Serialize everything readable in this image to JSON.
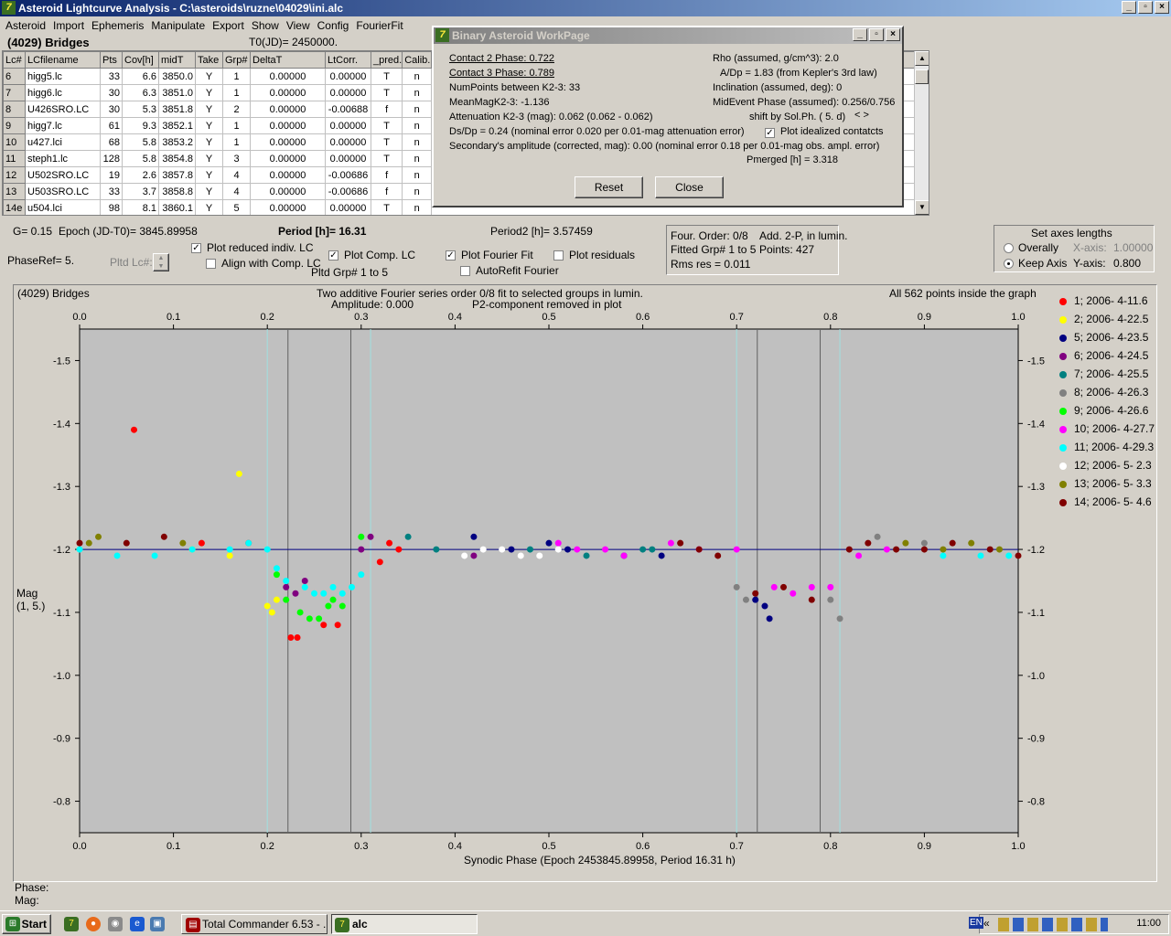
{
  "window": {
    "title": "Asteroid Lightcurve Analysis - C:\\asteroids\\ruzne\\04029\\ini.alc"
  },
  "menu": [
    "Asteroid",
    "Import",
    "Ephemeris",
    "Manipulate",
    "Export",
    "Show",
    "View",
    "Config",
    "FourierFit"
  ],
  "header": {
    "asteroid": "(4029) Bridges",
    "t0": "T0(JD)= 2450000."
  },
  "table": {
    "columns": [
      "Lc#",
      "LCfilename",
      "Pts",
      "Cov[h]",
      "midT",
      "Take",
      "Grp#",
      "DeltaT",
      "LtCorr.",
      "_pred.",
      "Calib."
    ],
    "rows": [
      [
        "6",
        "higg5.lc",
        "33",
        "6.6",
        "3850.0",
        "Y",
        "1",
        "0.00000",
        "0.00000",
        "T",
        "n"
      ],
      [
        "7",
        "higg6.lc",
        "30",
        "6.3",
        "3851.0",
        "Y",
        "1",
        "0.00000",
        "0.00000",
        "T",
        "n"
      ],
      [
        "8",
        "U426SRO.LC",
        "30",
        "5.3",
        "3851.8",
        "Y",
        "2",
        "0.00000",
        "-0.00688",
        "f",
        "n"
      ],
      [
        "9",
        "higg7.lc",
        "61",
        "9.3",
        "3852.1",
        "Y",
        "1",
        "0.00000",
        "0.00000",
        "T",
        "n"
      ],
      [
        "10",
        "u427.lci",
        "68",
        "5.8",
        "3853.2",
        "Y",
        "1",
        "0.00000",
        "0.00000",
        "T",
        "n"
      ],
      [
        "11",
        "steph1.lc",
        "128",
        "5.8",
        "3854.8",
        "Y",
        "3",
        "0.00000",
        "0.00000",
        "T",
        "n"
      ],
      [
        "12",
        "U502SRO.LC",
        "19",
        "2.6",
        "3857.8",
        "Y",
        "4",
        "0.00000",
        "-0.00686",
        "f",
        "n"
      ],
      [
        "13",
        "U503SRO.LC",
        "33",
        "3.7",
        "3858.8",
        "Y",
        "4",
        "0.00000",
        "-0.00686",
        "f",
        "n"
      ],
      [
        "14e",
        "u504.lci",
        "98",
        "8.1",
        "3860.1",
        "Y",
        "5",
        "0.00000",
        "0.00000",
        "T",
        "n"
      ]
    ]
  },
  "dialog": {
    "title": "Binary Asteroid WorkPage",
    "contact2": "Contact 2 Phase:   0.722",
    "contact3": "Contact 3 Phase:   0.789",
    "numpoints": "NumPoints between K2-3:    33",
    "meanmag": "MeanMagK2-3:  -1.136",
    "attenuation": "Attenuation K2-3 (mag):  0.062  (0.062 - 0.062)",
    "dsdp": "Ds/Dp = 0.24 (nominal error 0.020 per 0.01-mag attenuation error)",
    "secondary": "Secondary's amplitude (corrected, mag): 0.00 (nominal error 0.18 per 0.01-mag obs. ampl. error)",
    "rho": "Rho (assumed, g/cm^3): 2.0",
    "adp": "A/Dp = 1.83 (from Kepler's 3rd law)",
    "inclination": "Inclination (assumed, deg): 0",
    "midevent": "MidEvent Phase (assumed): 0.256/0.756",
    "shift": "shift by Sol.Ph. (  5. d)",
    "shift_arrows": "< >",
    "plot_idealized": "Plot idealized contatcts",
    "pmerged": "Pmerged [h] =  3.318",
    "reset": "Reset",
    "close": "Close"
  },
  "info": {
    "g": "G= 0.15",
    "epoch": "Epoch (JD-T0)= 3845.89958",
    "period": "Period [h]= 16.31",
    "period2": "Period2 [h]= 3.57459",
    "phaseref": "PhaseRef= 5.",
    "pltd_lc": "Pltd Lc#:",
    "plot_reduced": "Plot reduced indiv. LC",
    "align_comp": "Align with Comp. LC",
    "plot_comp": "Plot Comp. LC",
    "pltd_grp": "Pltd Grp#   1   to    5",
    "plot_fourier": "Plot Fourier Fit",
    "autorefit": "AutoRefit Fourier",
    "plot_residuals": "Plot residuals",
    "four_order": "Four. Order:  0/8",
    "add2p": "Add. 2-P, in lumin.",
    "fitted": "Fitted Grp# 1 to 5",
    "points": "Points: 427",
    "rms": "Rms res      = 0.011"
  },
  "axes_box": {
    "title": "Set axes lengths",
    "overally": "Overally",
    "keep": "Keep Axis",
    "xaxis": "X-axis:",
    "xval": "1.00000",
    "yaxis": "Y-axis:",
    "yval": "0.800"
  },
  "graph": {
    "name": "(4029) Bridges",
    "subtitle1": "Two additive Fourier series order 0/8 fit to selected groups in lumin.",
    "amp": "Amplitude: 0.000",
    "p2": "P2-component removed in plot",
    "inside": "All 562 points inside the graph",
    "ylabel1": "Mag",
    "ylabel2": "(1, 5.)",
    "xlabel": "Synodic Phase (Epoch 2453845.89958, Period 16.31 h)",
    "phase_lbl": "Phase:",
    "mag_lbl": "Mag:",
    "legend": [
      {
        "label": "1; 2006- 4-11.6",
        "color": "#ff0000"
      },
      {
        "label": "2; 2006- 4-22.5",
        "color": "#ffff00"
      },
      {
        "label": "5; 2006- 4-23.5",
        "color": "#000080"
      },
      {
        "label": "6; 2006- 4-24.5",
        "color": "#800080"
      },
      {
        "label": "7; 2006- 4-25.5",
        "color": "#008080"
      },
      {
        "label": "8; 2006- 4-26.3",
        "color": "#808080"
      },
      {
        "label": "9; 2006- 4-26.6",
        "color": "#00ff00"
      },
      {
        "label": "10; 2006- 4-27.7",
        "color": "#ff00ff"
      },
      {
        "label": "11; 2006- 4-29.3",
        "color": "#00ffff"
      },
      {
        "label": "12; 2006- 5- 2.3",
        "color": "#ffffff"
      },
      {
        "label": "13; 2006- 5- 3.3",
        "color": "#808000"
      },
      {
        "label": "14; 2006- 5- 4.6",
        "color": "#800000"
      }
    ]
  },
  "chart_data": {
    "type": "scatter",
    "xlabel": "Synodic Phase (Epoch 2453845.89958, Period 16.31 h)",
    "ylabel": "Mag",
    "xlim": [
      0.0,
      1.0
    ],
    "ylim": [
      -1.55,
      -0.75
    ],
    "y_inverted": true,
    "xticks": [
      "0.0",
      "0.1",
      "0.2",
      "0.3",
      "0.4",
      "0.5",
      "0.6",
      "0.7",
      "0.8",
      "0.9",
      "1.0"
    ],
    "yticks": [
      "-1.5",
      "-1.4",
      "-1.3",
      "-1.2",
      "-1.1",
      "-1.0",
      "-0.9",
      "-0.8"
    ],
    "fit_line": -1.2,
    "contact_lines": [
      0.222,
      0.289,
      0.722,
      0.789
    ],
    "light_lines": [
      0.2,
      0.31,
      0.7,
      0.81
    ],
    "series": [
      {
        "name": "1; 2006- 4-11.6",
        "color": "#ff0000",
        "x": [
          0.058,
          0.13,
          0.18,
          0.225,
          0.232,
          0.26,
          0.275,
          0.32,
          0.33,
          0.34
        ],
        "y": [
          -1.39,
          -1.21,
          -1.21,
          -1.06,
          -1.06,
          -1.08,
          -1.08,
          -1.18,
          -1.21,
          -1.2
        ]
      },
      {
        "name": "2; 2006- 4-22.5",
        "color": "#ffff00",
        "x": [
          0.17,
          0.12,
          0.16,
          0.2,
          0.205,
          0.21
        ],
        "y": [
          -1.32,
          -1.2,
          -1.19,
          -1.11,
          -1.1,
          -1.12
        ]
      },
      {
        "name": "5; 2006- 4-23.5",
        "color": "#000080",
        "x": [
          0.42,
          0.46,
          0.5,
          0.52,
          0.58,
          0.62,
          0.72,
          0.73,
          0.735
        ],
        "y": [
          -1.22,
          -1.2,
          -1.21,
          -1.2,
          -1.19,
          -1.19,
          -1.12,
          -1.11,
          -1.09
        ]
      },
      {
        "name": "6; 2006- 4-24.5",
        "color": "#800080",
        "x": [
          0.22,
          0.23,
          0.24,
          0.3,
          0.31,
          0.42
        ],
        "y": [
          -1.14,
          -1.13,
          -1.15,
          -1.2,
          -1.22,
          -1.19
        ]
      },
      {
        "name": "7; 2006- 4-25.5",
        "color": "#008080",
        "x": [
          0.35,
          0.38,
          0.48,
          0.54,
          0.6,
          0.61
        ],
        "y": [
          -1.22,
          -1.2,
          -1.2,
          -1.19,
          -1.2,
          -1.2
        ]
      },
      {
        "name": "8; 2006- 4-26.3",
        "color": "#808080",
        "x": [
          0.7,
          0.71,
          0.8,
          0.81,
          0.85,
          0.9
        ],
        "y": [
          -1.14,
          -1.12,
          -1.12,
          -1.09,
          -1.22,
          -1.21
        ]
      },
      {
        "name": "9; 2006- 4-26.6",
        "color": "#00ff00",
        "x": [
          0.21,
          0.22,
          0.235,
          0.245,
          0.255,
          0.265,
          0.27,
          0.28,
          0.3
        ],
        "y": [
          -1.16,
          -1.12,
          -1.1,
          -1.09,
          -1.09,
          -1.11,
          -1.12,
          -1.11,
          -1.22
        ]
      },
      {
        "name": "10; 2006- 4-27.7",
        "color": "#ff00ff",
        "x": [
          0.51,
          0.53,
          0.56,
          0.58,
          0.63,
          0.66,
          0.7,
          0.74,
          0.76,
          0.78,
          0.8,
          0.83,
          0.86
        ],
        "y": [
          -1.21,
          -1.2,
          -1.2,
          -1.19,
          -1.21,
          -1.2,
          -1.2,
          -1.14,
          -1.13,
          -1.14,
          -1.14,
          -1.19,
          -1.2
        ]
      },
      {
        "name": "11; 2006- 4-29.3",
        "color": "#00ffff",
        "x": [
          0.0,
          0.04,
          0.08,
          0.12,
          0.16,
          0.18,
          0.2,
          0.21,
          0.22,
          0.24,
          0.25,
          0.26,
          0.27,
          0.28,
          0.29,
          0.3,
          0.92,
          0.96,
          0.99
        ],
        "y": [
          -1.2,
          -1.19,
          -1.19,
          -1.2,
          -1.2,
          -1.21,
          -1.2,
          -1.17,
          -1.15,
          -1.14,
          -1.13,
          -1.13,
          -1.14,
          -1.13,
          -1.14,
          -1.16,
          -1.19,
          -1.19,
          -1.19
        ]
      },
      {
        "name": "12; 2006- 5- 2.3",
        "color": "#ffffff",
        "x": [
          0.41,
          0.43,
          0.45,
          0.47,
          0.49,
          0.51
        ],
        "y": [
          -1.19,
          -1.2,
          -1.2,
          -1.19,
          -1.19,
          -1.2
        ]
      },
      {
        "name": "13; 2006- 5- 3.3",
        "color": "#808000",
        "x": [
          0.01,
          0.02,
          0.11,
          0.88,
          0.92,
          0.95,
          0.98
        ],
        "y": [
          -1.21,
          -1.22,
          -1.21,
          -1.21,
          -1.2,
          -1.21,
          -1.2
        ]
      },
      {
        "name": "14; 2006- 5- 4.6",
        "color": "#800000",
        "x": [
          0.0,
          0.05,
          0.09,
          0.64,
          0.66,
          0.68,
          0.72,
          0.75,
          0.78,
          0.82,
          0.84,
          0.87,
          0.9,
          0.93,
          0.97,
          1.0
        ],
        "y": [
          -1.21,
          -1.21,
          -1.22,
          -1.21,
          -1.2,
          -1.19,
          -1.13,
          -1.14,
          -1.12,
          -1.2,
          -1.21,
          -1.2,
          -1.2,
          -1.21,
          -1.2,
          -1.19
        ]
      }
    ]
  },
  "taskbar": {
    "start": "Start",
    "task1": "Total Commander 6.53 - ...",
    "task2": "alc",
    "lang": "EN",
    "clock": "11:00"
  }
}
